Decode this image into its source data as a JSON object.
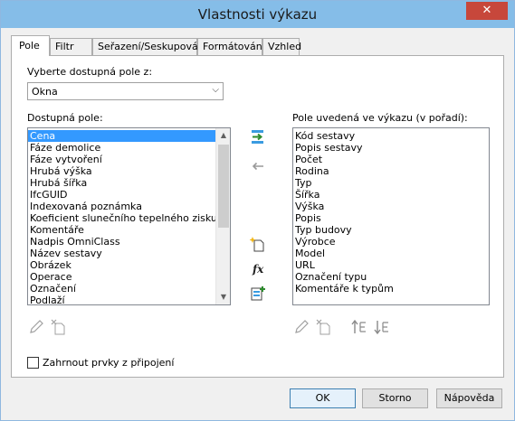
{
  "window": {
    "title": "Vlastnosti výkazu",
    "close_label": "✕"
  },
  "tabs": [
    {
      "label": "Pole"
    },
    {
      "label": "Filtr"
    },
    {
      "label": "Seřazení/Seskupování"
    },
    {
      "label": "Formátování"
    },
    {
      "label": "Vzhled"
    }
  ],
  "source": {
    "label": "Vyberte dostupná pole z:",
    "selected": "Okna"
  },
  "available": {
    "label": "Dostupná pole:",
    "items": [
      "Cena",
      "Fáze demolice",
      "Fáze vytvoření",
      "Hrubá výška",
      "Hrubá šířka",
      "IfcGUID",
      "Indexovaná poznámka",
      "Koeficient slunečního tepelného zisku",
      "Komentáře",
      "Nadpis OmniClass",
      "Název sestavy",
      "Obrázek",
      "Operace",
      "Označení",
      "Podlaží"
    ]
  },
  "scheduled": {
    "label": "Pole uvedená ve výkazu (v pořadí):",
    "items": [
      "Kód sestavy",
      "Popis sestavy",
      "Počet",
      "Rodina",
      "Typ",
      "Šířka",
      "Výška",
      "Popis",
      "Typ budovy",
      "Výrobce",
      "Model",
      "URL",
      "Označení typu",
      "Komentáře k typům"
    ]
  },
  "icons": {
    "add": "add-parameter-icon",
    "remove": "remove-parameter-icon",
    "new": "new-parameter-icon",
    "calc": "calculated-value-icon",
    "combine": "combine-parameters-icon",
    "edit": "edit-parameter-icon",
    "delete": "delete-parameter-icon",
    "up": "move-up-icon",
    "down": "move-down-icon"
  },
  "options": {
    "include_links_label": "Zahrnout prvky z připojení"
  },
  "buttons": {
    "ok": "OK",
    "cancel": "Storno",
    "help": "Nápověda"
  },
  "colors": {
    "title_bar": "#85bde8",
    "close": "#c7473b",
    "selection": "#3399ff"
  }
}
